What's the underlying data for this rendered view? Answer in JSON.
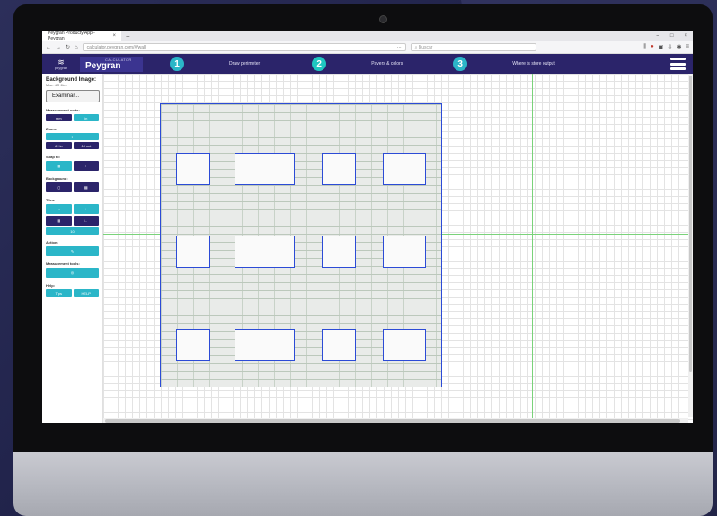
{
  "browser": {
    "tab_title": "Peygran Producty App - Peygran",
    "tab_close": "×",
    "new_tab": "+",
    "url": "calculator.peygran.com/#/wall",
    "url_dots": "···",
    "search_placeholder": "Buscar",
    "win_min": "–",
    "win_max": "□",
    "win_close": "×"
  },
  "header": {
    "logo_text": "peygran",
    "brand_small": "CALCULATOR",
    "brand_name": "Peygran",
    "steps": [
      {
        "num": "1",
        "label": "Draw perimeter"
      },
      {
        "num": "2",
        "label": "Pavers & colors"
      },
      {
        "num": "3",
        "label": "Where is store output"
      }
    ]
  },
  "sidebar": {
    "bg_title": "Background Image:",
    "bg_sub": "Max: 4M files",
    "browse_label": "Examinar...",
    "measurement_label": "Measurement units:",
    "units": [
      "mm",
      "in"
    ],
    "zoom_label": "Zoom:",
    "zoom_value": "1",
    "zoom_in": "All in",
    "zoom_out": "All out",
    "snap_label": "Snap to:",
    "background_label": "Background:",
    "tiles_label": "Tiles:",
    "tiles_value": "10",
    "action_label": "Action:",
    "measurement_tools_label": "Measurement tools:",
    "help_label": "Help:",
    "help_items": [
      "Tips",
      "HELP"
    ]
  },
  "colors": {
    "header_bg": "#2b246a",
    "accent": "#2bb6c8",
    "wall_outline": "#2c4bd6",
    "guide_line": "#7ad27a"
  }
}
